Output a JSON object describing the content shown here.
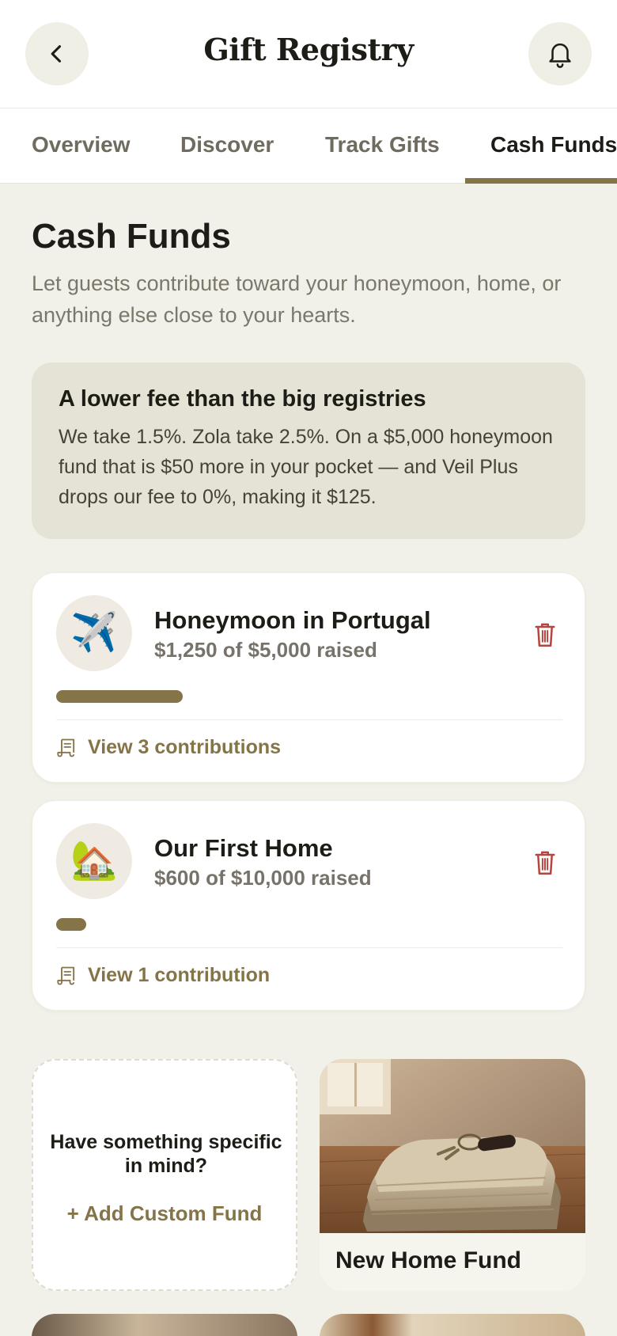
{
  "header": {
    "title": "Gift Registry",
    "back_icon": "chevron-left-icon",
    "bell_icon": "bell-icon"
  },
  "tabs": [
    {
      "label": "Overview",
      "active": false
    },
    {
      "label": "Discover",
      "active": false
    },
    {
      "label": "Track Gifts",
      "active": false
    },
    {
      "label": "Cash Funds",
      "active": true
    }
  ],
  "page": {
    "title": "Cash Funds",
    "subtitle": "Let guests contribute toward your honeymoon, home, or anything else close to your hearts."
  },
  "fee_box": {
    "title": "A lower fee than the big registries",
    "body": "We take 1.5%. Zola take 2.5%. On a $5,000 honeymoon fund that is $50 more in your pocket — and Veil Plus drops our fee to 0%, making it $125."
  },
  "funds": [
    {
      "icon": "✈️",
      "name": "Honeymoon in Portugal",
      "raised_text": "$1,250 of $5,000 raised",
      "progress": 0.25,
      "link": "View 3 contributions"
    },
    {
      "icon": "🏡",
      "name": "Our First Home",
      "raised_text": "$600 of $10,000 raised",
      "progress": 0.06,
      "link": "View 1 contribution"
    }
  ],
  "custom_card": {
    "question": "Have something specific in mind?",
    "action": "+ Add Custom Fund"
  },
  "suggested": [
    {
      "label": "New Home Fund"
    }
  ],
  "colors": {
    "accent": "#857448",
    "background": "#f1f1e9",
    "fee_box": "#e4e3d5",
    "trash": "#b5453f"
  }
}
